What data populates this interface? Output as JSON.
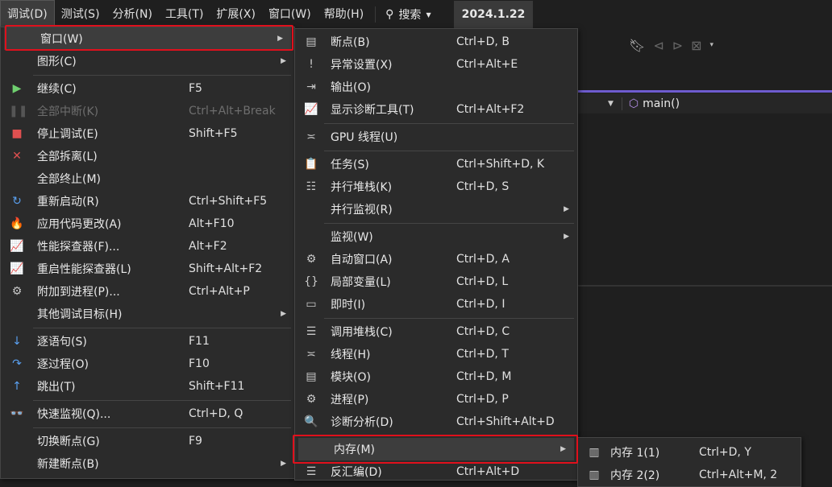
{
  "menubar": {
    "items": [
      "调试(D)",
      "测试(S)",
      "分析(N)",
      "工具(T)",
      "扩展(X)",
      "窗口(W)",
      "帮助(H)"
    ],
    "search": "搜索",
    "version": "2024.1.22"
  },
  "editor": {
    "function": "main()"
  },
  "debug_menu": {
    "items": [
      {
        "label": "窗口(W)",
        "sub": true,
        "hl": true,
        "icon": ""
      },
      {
        "label": "图形(C)",
        "sub": true,
        "icon": ""
      },
      {
        "sep": true
      },
      {
        "label": "继续(C)",
        "shortcut": "F5",
        "icon": "play-icon"
      },
      {
        "label": "全部中断(K)",
        "shortcut": "Ctrl+Alt+Break",
        "icon": "pause-icon",
        "disabled": true
      },
      {
        "label": "停止调试(E)",
        "shortcut": "Shift+F5",
        "icon": "stop-icon"
      },
      {
        "label": "全部拆离(L)",
        "icon": "close-icon"
      },
      {
        "label": "全部终止(M)",
        "icon": ""
      },
      {
        "label": "重新启动(R)",
        "shortcut": "Ctrl+Shift+F5",
        "icon": "restart-icon"
      },
      {
        "label": "应用代码更改(A)",
        "shortcut": "Alt+F10",
        "icon": "hot-reload-icon"
      },
      {
        "label": "性能探查器(F)...",
        "shortcut": "Alt+F2",
        "icon": "profiler-icon"
      },
      {
        "label": "重启性能探查器(L)",
        "shortcut": "Shift+Alt+F2",
        "icon": "profiler-restart-icon"
      },
      {
        "label": "附加到进程(P)...",
        "shortcut": "Ctrl+Alt+P",
        "icon": "gears-icon"
      },
      {
        "label": "其他调试目标(H)",
        "sub": true,
        "icon": ""
      },
      {
        "sep": true
      },
      {
        "label": "逐语句(S)",
        "shortcut": "F11",
        "icon": "step-into-icon"
      },
      {
        "label": "逐过程(O)",
        "shortcut": "F10",
        "icon": "step-over-icon"
      },
      {
        "label": "跳出(T)",
        "shortcut": "Shift+F11",
        "icon": "step-out-icon"
      },
      {
        "sep": true
      },
      {
        "label": "快速监视(Q)...",
        "shortcut": "Ctrl+D, Q",
        "icon": "glasses-icon"
      },
      {
        "sep": true
      },
      {
        "label": "切换断点(G)",
        "shortcut": "F9",
        "icon": ""
      },
      {
        "label": "新建断点(B)",
        "sub": true,
        "icon": ""
      }
    ]
  },
  "window_menu": {
    "items": [
      {
        "label": "断点(B)",
        "shortcut": "Ctrl+D, B",
        "icon": "breakpoints-icon"
      },
      {
        "label": "异常设置(X)",
        "shortcut": "Ctrl+Alt+E",
        "icon": "exception-settings-icon"
      },
      {
        "label": "输出(O)",
        "icon": "output-icon"
      },
      {
        "label": "显示诊断工具(T)",
        "shortcut": "Ctrl+Alt+F2",
        "icon": "diagnostic-tools-icon"
      },
      {
        "sep": true
      },
      {
        "label": "GPU 线程(U)",
        "icon": "gpu-threads-icon"
      },
      {
        "sep": true
      },
      {
        "label": "任务(S)",
        "shortcut": "Ctrl+Shift+D, K",
        "icon": "tasks-icon"
      },
      {
        "label": "并行堆栈(K)",
        "shortcut": "Ctrl+D, S",
        "icon": "parallel-stacks-icon"
      },
      {
        "label": "并行监视(R)",
        "sub": true,
        "icon": ""
      },
      {
        "sep": true
      },
      {
        "label": "监视(W)",
        "sub": true,
        "icon": ""
      },
      {
        "label": "自动窗口(A)",
        "shortcut": "Ctrl+D, A",
        "icon": "autos-icon"
      },
      {
        "label": "局部变量(L)",
        "shortcut": "Ctrl+D, L",
        "icon": "locals-icon"
      },
      {
        "label": "即时(I)",
        "shortcut": "Ctrl+D, I",
        "icon": "immediate-icon"
      },
      {
        "sep": true
      },
      {
        "label": "调用堆栈(C)",
        "shortcut": "Ctrl+D, C",
        "icon": "call-stack-icon"
      },
      {
        "label": "线程(H)",
        "shortcut": "Ctrl+D, T",
        "icon": "threads-icon"
      },
      {
        "label": "模块(O)",
        "shortcut": "Ctrl+D, M",
        "icon": "modules-icon"
      },
      {
        "label": "进程(P)",
        "shortcut": "Ctrl+D, P",
        "icon": "processes-icon"
      },
      {
        "label": "诊断分析(D)",
        "shortcut": "Ctrl+Shift+Alt+D",
        "icon": "diagnostic-analysis-icon"
      },
      {
        "sep": true
      },
      {
        "label": "内存(M)",
        "sub": true,
        "hl": true,
        "icon": ""
      },
      {
        "label": "反汇编(D)",
        "shortcut": "Ctrl+Alt+D",
        "icon": "disassembly-icon"
      }
    ]
  },
  "memory_menu": {
    "items": [
      {
        "label": "内存 1(1)",
        "shortcut": "Ctrl+D, Y",
        "icon": "memory-icon"
      },
      {
        "label": "内存 2(2)",
        "shortcut": "Ctrl+Alt+M, 2",
        "icon": "memory-icon"
      }
    ]
  },
  "icons": {
    "play-icon": "▶",
    "pause-icon": "❚❚",
    "stop-icon": "■",
    "close-icon": "✕",
    "restart-icon": "↻",
    "hot-reload-icon": "🔥",
    "profiler-icon": "📈",
    "profiler-restart-icon": "📈",
    "gears-icon": "⚙",
    "step-into-icon": "↓",
    "step-over-icon": "↷",
    "step-out-icon": "↑",
    "glasses-icon": "👓",
    "breakpoints-icon": "▤",
    "exception-settings-icon": "!",
    "output-icon": "⇥",
    "diagnostic-tools-icon": "📈",
    "gpu-threads-icon": "≍",
    "tasks-icon": "📋",
    "parallel-stacks-icon": "☷",
    "autos-icon": "⚙",
    "locals-icon": "{}",
    "immediate-icon": "▭",
    "call-stack-icon": "☰",
    "threads-icon": "≍",
    "modules-icon": "▤",
    "processes-icon": "⚙",
    "diagnostic-analysis-icon": "🔍",
    "disassembly-icon": "☰",
    "memory-icon": "▥"
  },
  "colors": {
    "play-icon": "#6fcf6f",
    "stop-icon": "#e05050",
    "close-icon": "#e05050",
    "hot-reload-icon": "#e05050",
    "restart-icon": "#5aa0f0",
    "step-into-icon": "#5aa0f0",
    "step-over-icon": "#5aa0f0",
    "step-out-icon": "#5aa0f0",
    "highlight": "#e0101c"
  }
}
